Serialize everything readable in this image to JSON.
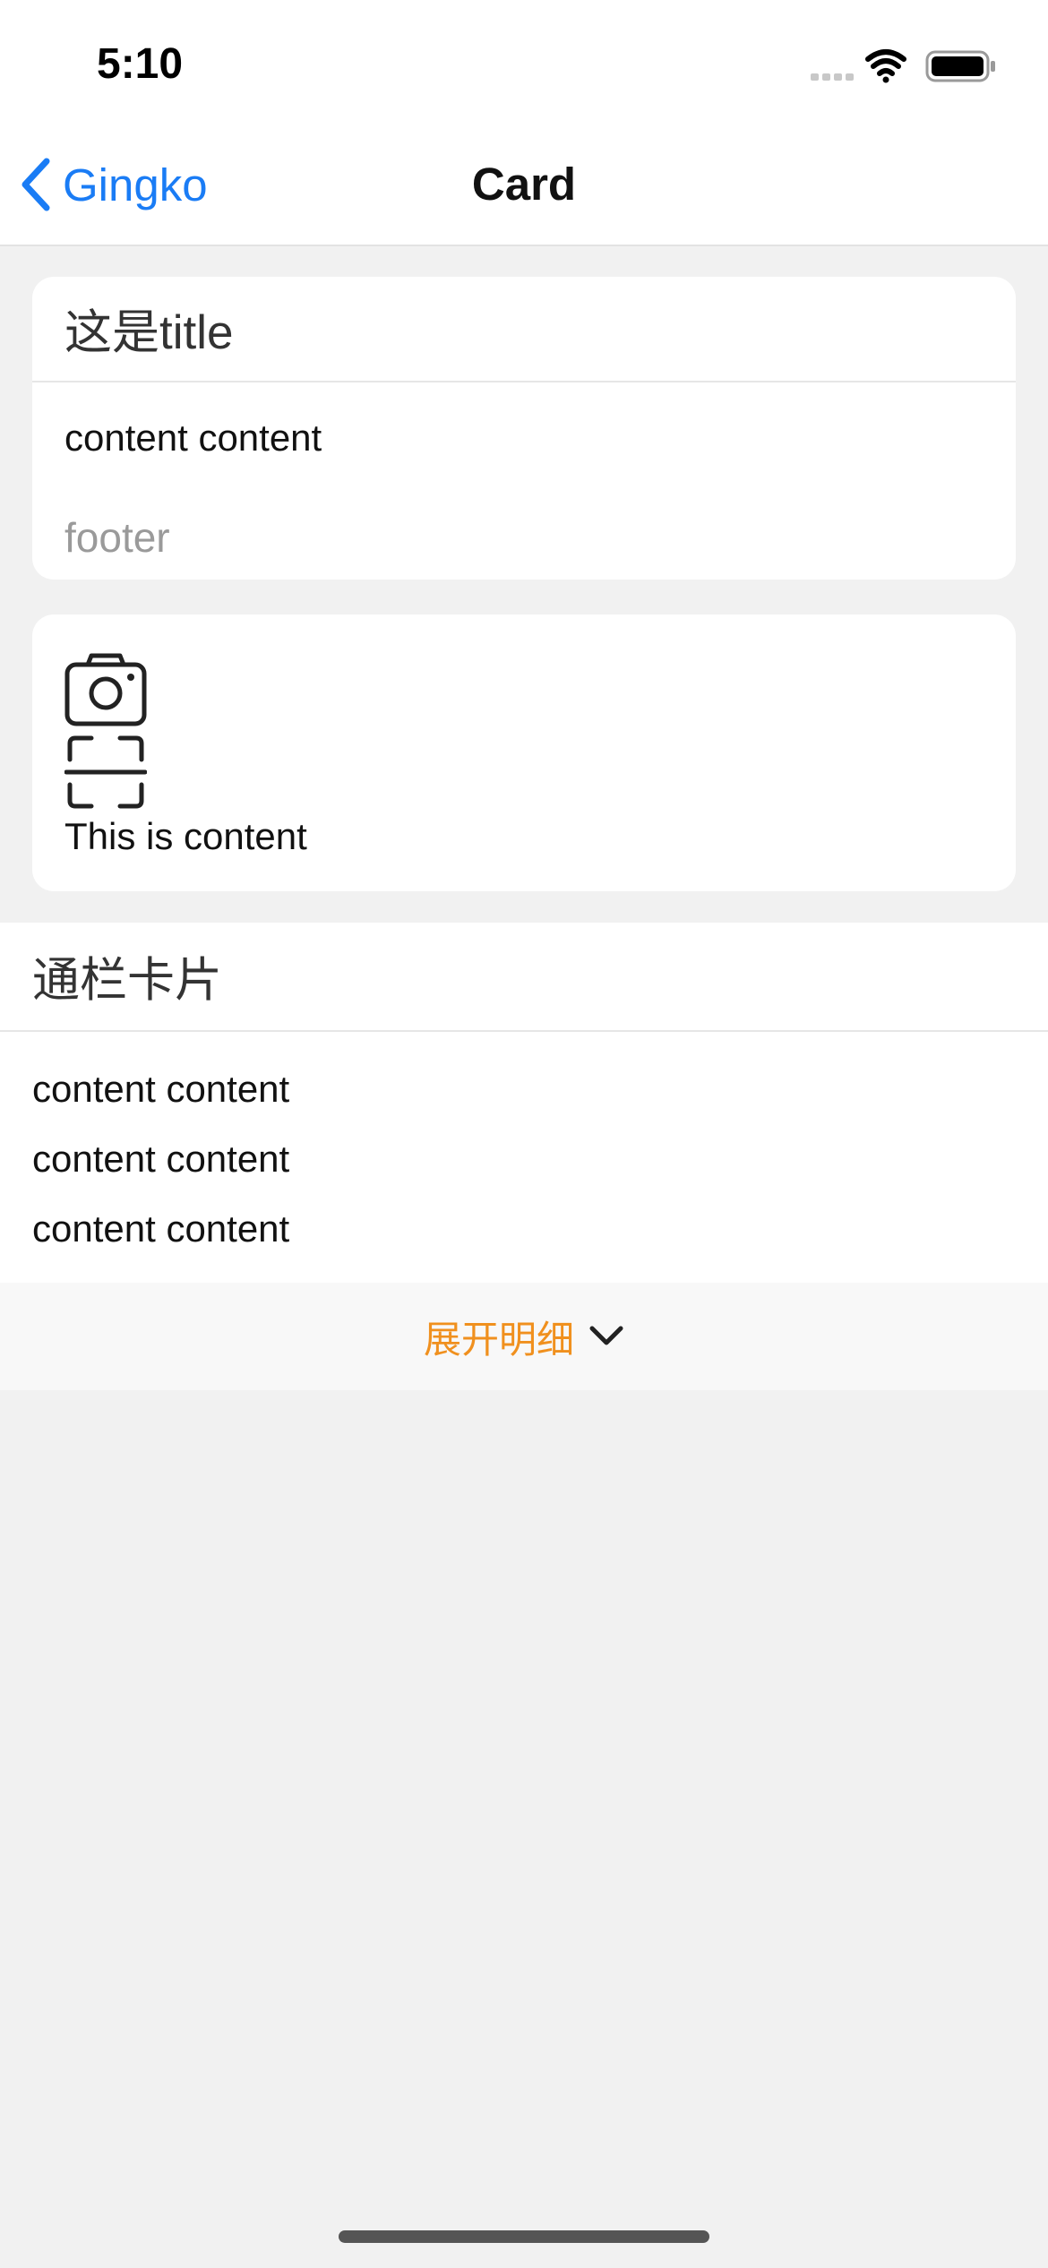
{
  "status_bar": {
    "time": "5:10",
    "icons": [
      "cellular-signal-icon",
      "wifi-icon",
      "battery-icon"
    ]
  },
  "nav": {
    "back_label": "Gingko",
    "title": "Card",
    "accent_color": "#1a7cf5"
  },
  "card1": {
    "title": "这是title",
    "content": "content content",
    "footer": "footer"
  },
  "card2": {
    "icons": [
      "camera-icon",
      "scan-icon"
    ],
    "content": "This is content"
  },
  "banner_card": {
    "title": "通栏卡片",
    "lines": [
      "content content",
      "content content",
      "content content"
    ],
    "expand_label": "展开明细",
    "expand_color": "#f0901e"
  }
}
